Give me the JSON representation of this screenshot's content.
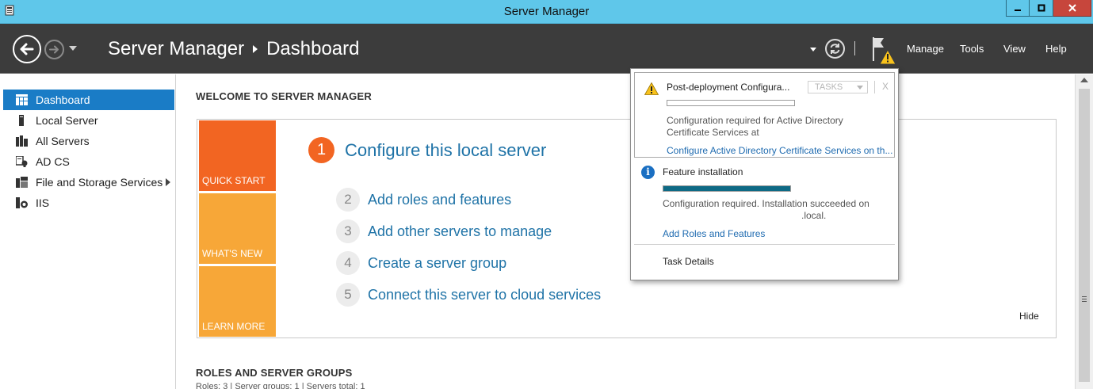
{
  "window": {
    "title": "Server Manager",
    "buttons": [
      "minimize",
      "maximize",
      "close"
    ]
  },
  "header": {
    "breadcrumb_app": "Server Manager",
    "breadcrumb_page": "Dashboard",
    "menu": {
      "manage": "Manage",
      "tools": "Tools",
      "view": "View",
      "help": "Help"
    }
  },
  "sidebar": {
    "items": [
      {
        "label": "Dashboard",
        "icon": "dashboard-icon",
        "active": true
      },
      {
        "label": "Local Server",
        "icon": "server-icon"
      },
      {
        "label": "All Servers",
        "icon": "servers-icon"
      },
      {
        "label": "AD CS",
        "icon": "certificate-icon"
      },
      {
        "label": "File and Storage Services",
        "icon": "storage-icon",
        "has_submenu": true
      },
      {
        "label": "IIS",
        "icon": "iis-icon"
      }
    ]
  },
  "main": {
    "welcome_title": "WELCOME TO SERVER MANAGER",
    "tiles": {
      "quick_start": "QUICK START",
      "whats_new": "WHAT'S NEW",
      "learn_more": "LEARN MORE"
    },
    "steps": [
      {
        "num": "1",
        "label": "Configure this local server"
      },
      {
        "num": "2",
        "label": "Add roles and features"
      },
      {
        "num": "3",
        "label": "Add other servers to manage"
      },
      {
        "num": "4",
        "label": "Create a server group"
      },
      {
        "num": "5",
        "label": "Connect this server to cloud services"
      }
    ],
    "hide_label": "Hide",
    "roles_title": "ROLES AND SERVER GROUPS",
    "roles_summary": "Roles: 3   |   Server groups: 1   |   Servers total: 1"
  },
  "notifications": {
    "post_deploy": {
      "title": "Post-deployment Configura...",
      "tasks_label": "TASKS",
      "close_label": "X",
      "progress": 0,
      "text_line1": "Configuration required for Active Directory",
      "text_line2": "Certificate Services at",
      "link": "Configure Active Directory Certificate Services on th..."
    },
    "feature_install": {
      "title": "Feature installation",
      "progress": 1,
      "text_line1": "Configuration required. Installation succeeded on",
      "text_line2": ".local.",
      "link": "Add Roles and Features"
    },
    "task_details": "Task Details"
  },
  "colors": {
    "titlebar": "#5fc7ea",
    "header": "#3c3c3c",
    "accent_orange": "#f26522",
    "tile_yellow": "#f7a738",
    "link_blue": "#1f73a7",
    "selection": "#1a7cc6",
    "progress_fill": "#0e6a85"
  }
}
